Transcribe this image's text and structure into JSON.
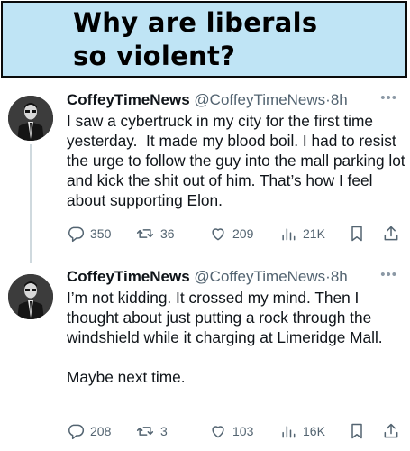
{
  "banner": {
    "title_line1": "Why are liberals",
    "title_line2": "so violent?"
  },
  "tweets": [
    {
      "display_name": "CoffeyTimeNews",
      "handle": "@CoffeyTimeNews",
      "separator": "·",
      "time": "8h",
      "text": "I saw a cybertruck in my city for the first time yesterday.  It made my blood boil. I had to resist the urge to follow the guy into the mall parking lot and kick the shit out of him. That’s how I feel about supporting Elon.",
      "replies": "350",
      "reposts": "36",
      "likes": "209",
      "views": "21K"
    },
    {
      "display_name": "CoffeyTimeNews",
      "handle": "@CoffeyTimeNews",
      "separator": "·",
      "time": "8h",
      "text": "I’m not kidding. It crossed my mind. Then I thought about just putting a rock through the windshield while it charging at Limeridge Mall.\n\nMaybe next time.",
      "replies": "208",
      "reposts": "3",
      "likes": "103",
      "views": "16K"
    }
  ],
  "icons": [
    "reply-icon",
    "repost-icon",
    "like-icon",
    "views-icon",
    "bookmark-icon",
    "share-icon",
    "more-icon"
  ],
  "colors": {
    "banner_bg": "#bfe4f5",
    "text": "#0f1419",
    "secondary": "#536471"
  }
}
